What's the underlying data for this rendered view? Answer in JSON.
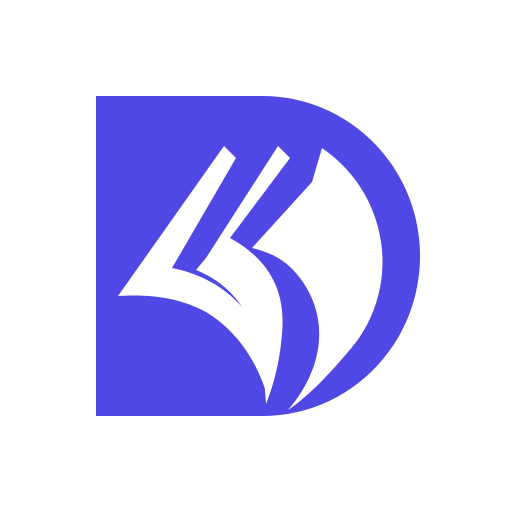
{
  "logo": {
    "name": "book-d-logo-icon",
    "colors": {
      "background": "#ffffff",
      "brand": "#5048e5",
      "pages": "#ffffff"
    }
  }
}
